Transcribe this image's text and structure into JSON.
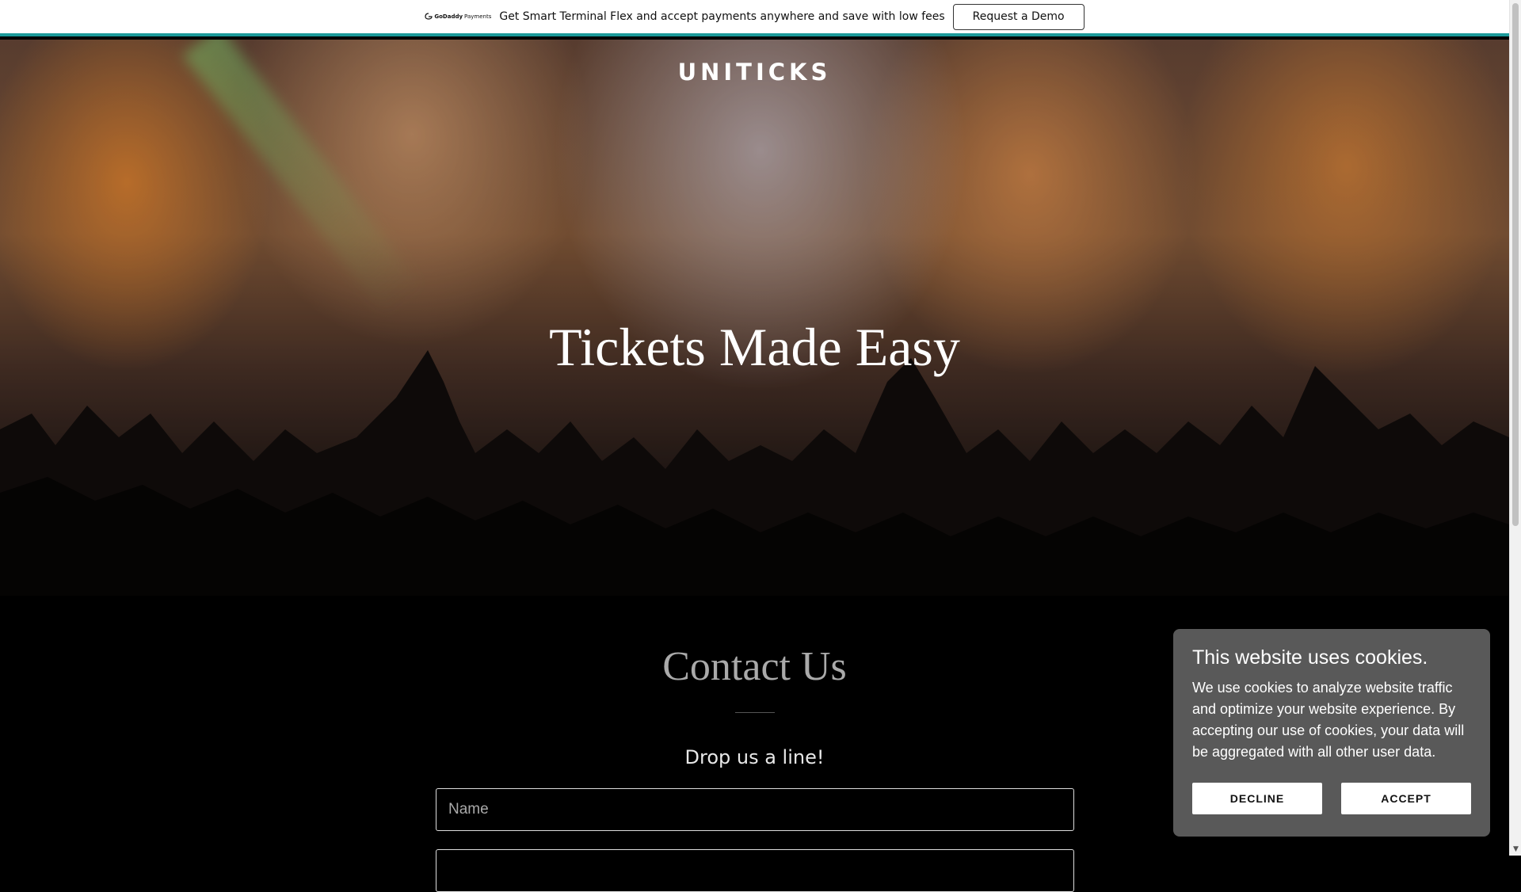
{
  "promo": {
    "logo_text_strong": "GoDaddy",
    "logo_text": "Payments",
    "logo_icon": "godaddy-logo-icon",
    "message": "Get Smart Terminal Flex and accept payments anywhere and save with low fees",
    "button_label": "Request a Demo",
    "accent_color": "#1b9a9a"
  },
  "hero": {
    "site_title": "UNITICKS",
    "heading": "Tickets Made Easy"
  },
  "contact": {
    "title": "Contact Us",
    "subtitle": "Drop us a line!",
    "name_placeholder": "Name",
    "email_placeholder": ""
  },
  "cookie": {
    "title": "This website uses cookies.",
    "text": "We use cookies to analyze website traffic and optimize your website experience. By accepting our use of cookies, your data will be aggregated with all other user data.",
    "decline_label": "DECLINE",
    "accept_label": "ACCEPT",
    "background_color": "#595959"
  },
  "scrollbar": {
    "down_arrow_icon": "chevron-down-icon"
  }
}
